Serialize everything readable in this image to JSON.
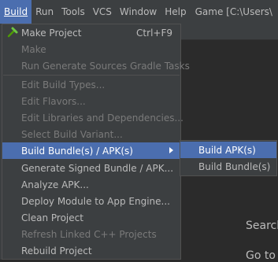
{
  "menubar": {
    "items": [
      {
        "label": "Build",
        "mnemonic_index": 0,
        "active": true
      },
      {
        "label": "Run",
        "mnemonic_index": 1
      },
      {
        "label": "Tools",
        "mnemonic_index": 0
      },
      {
        "label": "VCS",
        "mnemonic_index": 1
      },
      {
        "label": "Window",
        "mnemonic_index": 0
      },
      {
        "label": "Help",
        "mnemonic_index": 0
      }
    ],
    "window_title": "Game [C:\\Users\\"
  },
  "editor": {
    "hint_1": "Search",
    "hint_2": "Go to"
  },
  "build_menu": {
    "items": [
      {
        "label": "Make Project",
        "shortcut": "Ctrl+F9",
        "icon": "hammer-icon",
        "enabled": true
      },
      {
        "label": "Make",
        "enabled": false
      },
      {
        "label": "Run Generate Sources Gradle Tasks",
        "enabled": false
      },
      {
        "label": "Edit Build Types...",
        "enabled": false
      },
      {
        "label": "Edit Flavors...",
        "enabled": false
      },
      {
        "label": "Edit Libraries and Dependencies...",
        "enabled": false
      },
      {
        "label": "Select Build Variant...",
        "enabled": false
      },
      {
        "label": "Build Bundle(s) / APK(s)",
        "enabled": true,
        "submenu": true,
        "selected": true
      },
      {
        "label": "Generate Signed Bundle / APK...",
        "enabled": true
      },
      {
        "label": "Analyze APK...",
        "enabled": true
      },
      {
        "label": "Deploy Module to App Engine...",
        "enabled": true
      },
      {
        "label": "Clean Project",
        "enabled": true
      },
      {
        "label": "Refresh Linked C++ Projects",
        "enabled": false
      },
      {
        "label": "Rebuild Project",
        "enabled": true
      }
    ]
  },
  "submenu": {
    "items": [
      {
        "label": "Build APK(s)",
        "selected": true
      },
      {
        "label": "Build Bundle(s)",
        "selected": false
      }
    ]
  },
  "colors": {
    "menu_bg": "#3c3f41",
    "selection": "#4b6eaf",
    "text": "#bbbbbb",
    "disabled_text": "#7a7a7a",
    "editor_bg": "#2b2b2b"
  }
}
